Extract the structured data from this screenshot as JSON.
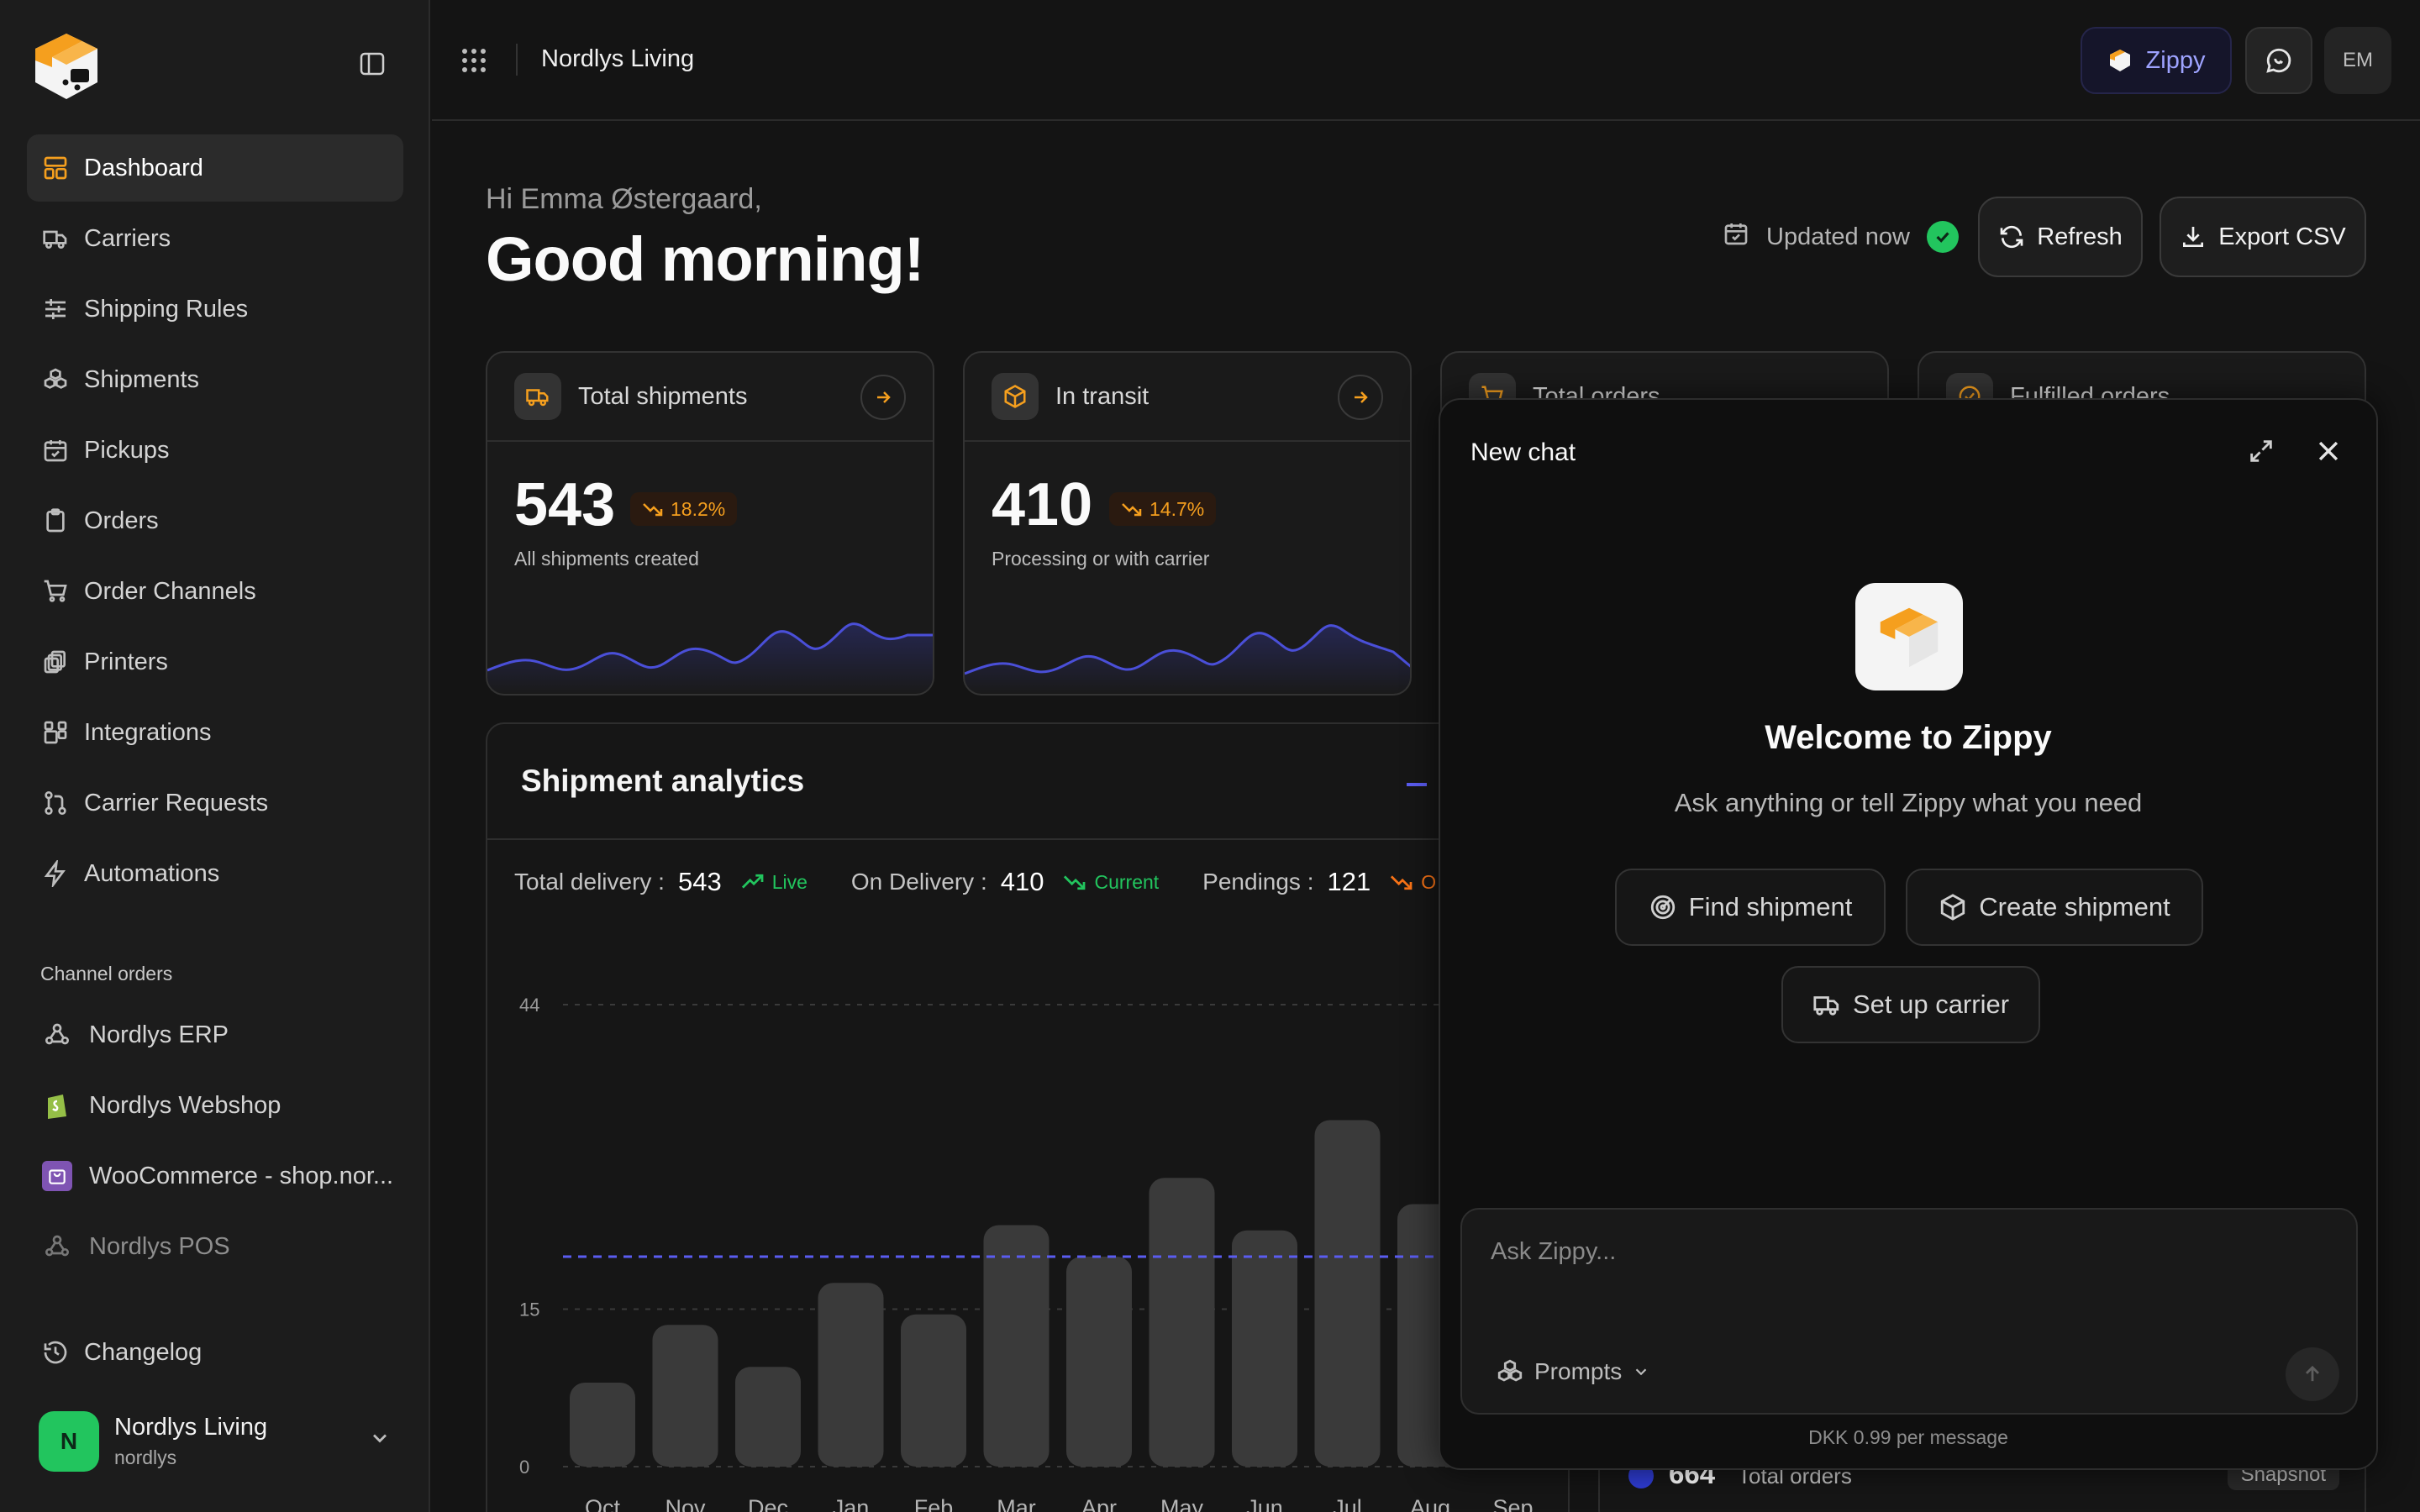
{
  "app": {
    "org_name": "Nordlys Living",
    "accent": "#f59f1e"
  },
  "sidebar": {
    "nav": [
      {
        "label": "Dashboard",
        "icon": "dashboard-icon",
        "active": true
      },
      {
        "label": "Carriers",
        "icon": "truck-icon"
      },
      {
        "label": "Shipping Rules",
        "icon": "sliders-icon"
      },
      {
        "label": "Shipments",
        "icon": "boxes-icon"
      },
      {
        "label": "Pickups",
        "icon": "calendar-check-icon"
      },
      {
        "label": "Orders",
        "icon": "clipboard-icon"
      },
      {
        "label": "Order Channels",
        "icon": "cart-icon"
      },
      {
        "label": "Printers",
        "icon": "printer-icon"
      },
      {
        "label": "Integrations",
        "icon": "blocks-icon"
      },
      {
        "label": "Carrier Requests",
        "icon": "git-pull-icon"
      },
      {
        "label": "Automations",
        "icon": "bolt-icon"
      }
    ],
    "channels_label": "Channel orders",
    "channels": [
      {
        "label": "Nordlys ERP",
        "icon": "webhook-icon"
      },
      {
        "label": "Nordlys Webshop",
        "icon": "shopify-icon"
      },
      {
        "label": "WooCommerce - shop.nor...",
        "icon": "woocommerce-icon"
      },
      {
        "label": "Nordlys POS",
        "icon": "webhook-icon"
      }
    ],
    "changelog": "Changelog",
    "account": {
      "initial": "N",
      "name": "Nordlys Living",
      "handle": "nordlys"
    }
  },
  "topbar": {
    "title": "Nordlys Living",
    "zippy": "Zippy",
    "user_initials": "EM"
  },
  "greeting": {
    "hi": "Hi Emma Østergaard,",
    "title": "Good morning!"
  },
  "status": {
    "updated": "Updated now"
  },
  "actions": {
    "refresh": "Refresh",
    "export": "Export CSV"
  },
  "kpis": [
    {
      "title": "Total shipments",
      "value": "543",
      "delta": "18.2%",
      "sub": "All shipments created"
    },
    {
      "title": "In transit",
      "value": "410",
      "delta": "14.7%",
      "sub": "Processing or with carrier"
    },
    {
      "title": "Total orders"
    },
    {
      "title": "Fulfilled orders"
    }
  ],
  "analytics": {
    "title": "Shipment analytics",
    "stats": [
      {
        "label": "Total delivery :",
        "value": "543",
        "tag": "Live",
        "color": "#22c55e"
      },
      {
        "label": "On Delivery :",
        "value": "410",
        "tag": "Current",
        "color": "#22c55e"
      },
      {
        "label": "Pendings :",
        "value": "121",
        "tag": "O",
        "color": "#f97316"
      }
    ]
  },
  "chart_data": {
    "type": "bar",
    "categories": [
      "Oct",
      "Nov",
      "Dec",
      "Jan",
      "Feb",
      "Mar",
      "Apr",
      "May",
      "Jun",
      "Jul",
      "Aug",
      "Sep"
    ],
    "values": [
      8,
      13.5,
      9.5,
      17.5,
      14.5,
      23,
      20,
      27.5,
      22.5,
      33,
      25,
      0
    ],
    "yticks": [
      0,
      15,
      44
    ],
    "ylim": [
      0,
      44
    ],
    "reference_line": 20,
    "bar_color": "#3a3a3a",
    "reference_color": "#5a5cf0"
  },
  "snapshot": {
    "value": "664",
    "label": "Total orders",
    "pill": "Snapshot"
  },
  "chat": {
    "title": "New chat",
    "welcome": "Welcome to Zippy",
    "subtitle": "Ask anything or tell Zippy what you need",
    "quick_actions": [
      "Find shipment",
      "Create shipment",
      "Set up carrier"
    ],
    "placeholder": "Ask Zippy...",
    "prompts": "Prompts",
    "price": "DKK 0.99 per message"
  }
}
